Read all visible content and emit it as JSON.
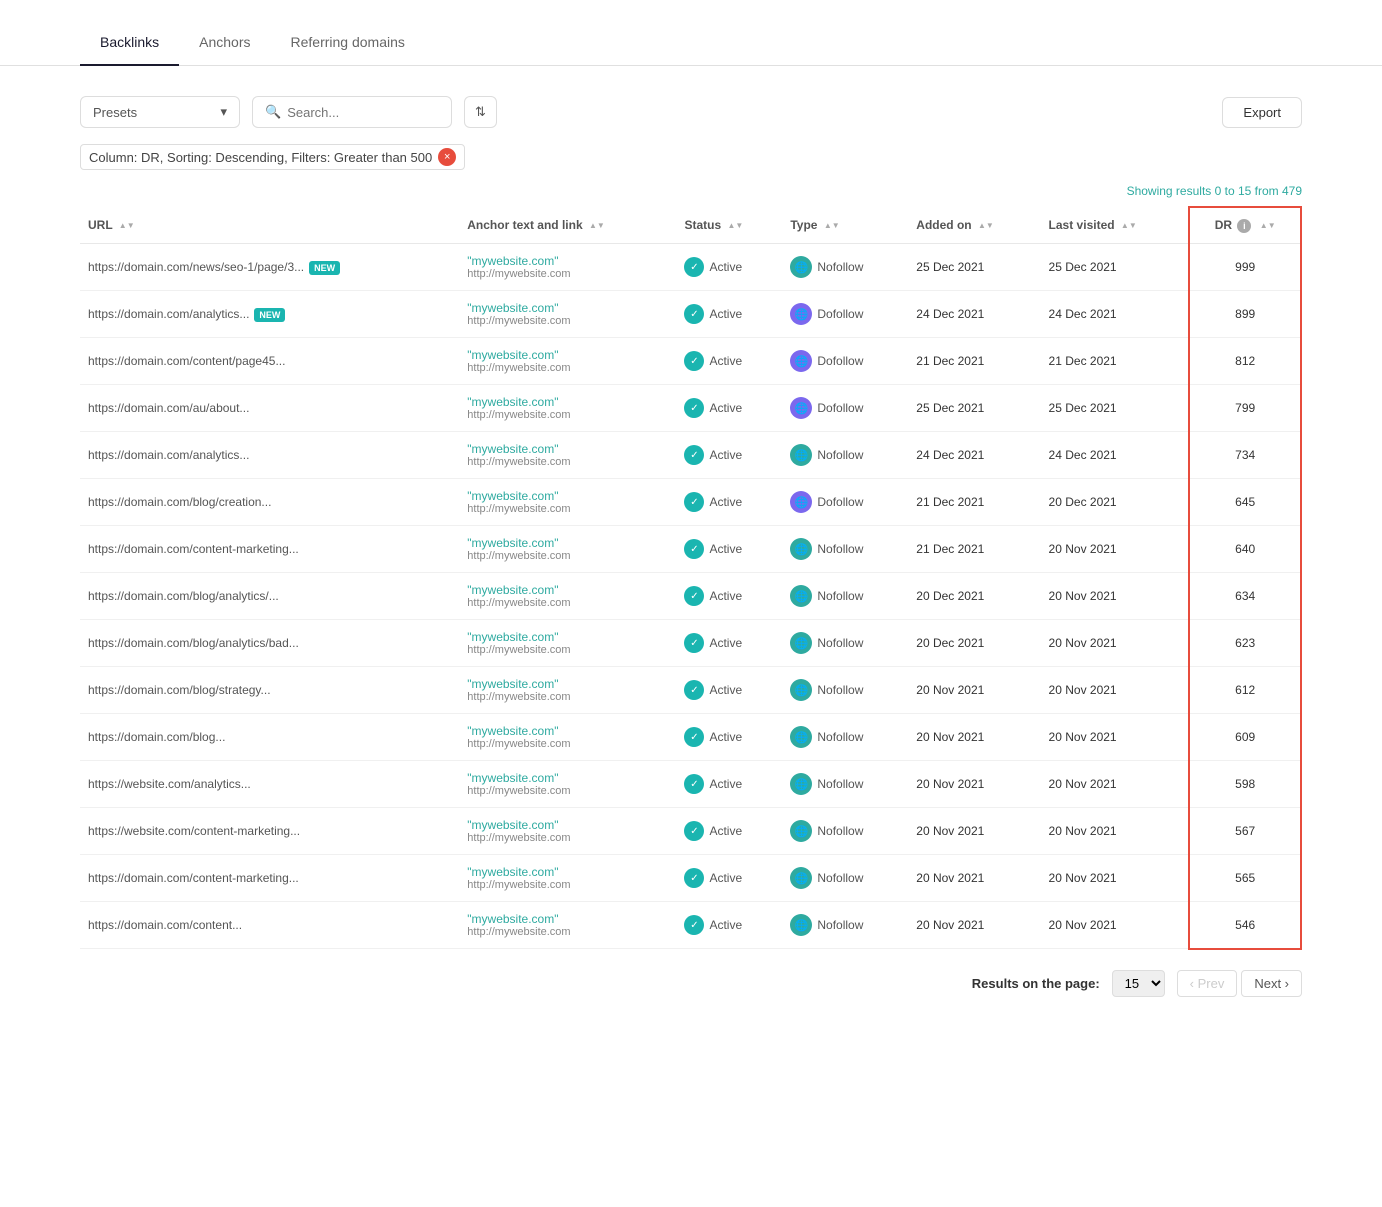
{
  "tabs": [
    {
      "id": "backlinks",
      "label": "Backlinks",
      "active": true
    },
    {
      "id": "anchors",
      "label": "Anchors",
      "active": false
    },
    {
      "id": "referring-domains",
      "label": "Referring domains",
      "active": false
    }
  ],
  "toolbar": {
    "presets_label": "Presets",
    "search_placeholder": "Search...",
    "export_label": "Export"
  },
  "active_filter": {
    "text": "Column: DR,  Sorting: Descending,  Filters: Greater than 500",
    "close_icon": "×"
  },
  "results": {
    "text": "Showing results 0 to 15 from 479"
  },
  "columns": [
    {
      "id": "url",
      "label": "URL"
    },
    {
      "id": "anchor",
      "label": "Anchor text and link"
    },
    {
      "id": "status",
      "label": "Status"
    },
    {
      "id": "type",
      "label": "Type"
    },
    {
      "id": "added_on",
      "label": "Added on"
    },
    {
      "id": "last_visited",
      "label": "Last visited"
    },
    {
      "id": "dr",
      "label": "DR"
    }
  ],
  "rows": [
    {
      "url": "https://domain.com/news/seo-1/page/3...",
      "is_new": true,
      "anchor_text": "\"mywebsite.com\"",
      "anchor_link": "http://mywebsite.com",
      "status": "Active",
      "type": "Nofollow",
      "type_style": "nofollow",
      "added_on": "25 Dec 2021",
      "last_visited": "25 Dec 2021",
      "dr": 999
    },
    {
      "url": "https://domain.com/analytics...",
      "is_new": true,
      "anchor_text": "\"mywebsite.com\"",
      "anchor_link": "http://mywebsite.com",
      "status": "Active",
      "type": "Dofollow",
      "type_style": "dofollow",
      "added_on": "24 Dec 2021",
      "last_visited": "24 Dec 2021",
      "dr": 899
    },
    {
      "url": "https://domain.com/content/page45...",
      "is_new": false,
      "anchor_text": "\"mywebsite.com\"",
      "anchor_link": "http://mywebsite.com",
      "status": "Active",
      "type": "Dofollow",
      "type_style": "dofollow",
      "added_on": "21 Dec 2021",
      "last_visited": "21 Dec 2021",
      "dr": 812
    },
    {
      "url": "https://domain.com/au/about...",
      "is_new": false,
      "anchor_text": "\"mywebsite.com\"",
      "anchor_link": "http://mywebsite.com",
      "status": "Active",
      "type": "Dofollow",
      "type_style": "dofollow",
      "added_on": "25 Dec 2021",
      "last_visited": "25 Dec 2021",
      "dr": 799
    },
    {
      "url": "https://domain.com/analytics...",
      "is_new": false,
      "anchor_text": "\"mywebsite.com\"",
      "anchor_link": "http://mywebsite.com",
      "status": "Active",
      "type": "Nofollow",
      "type_style": "nofollow",
      "added_on": "24 Dec 2021",
      "last_visited": "24 Dec 2021",
      "dr": 734
    },
    {
      "url": "https://domain.com/blog/creation...",
      "is_new": false,
      "anchor_text": "\"mywebsite.com\"",
      "anchor_link": "http://mywebsite.com",
      "status": "Active",
      "type": "Dofollow",
      "type_style": "dofollow",
      "added_on": "21 Dec 2021",
      "last_visited": "20 Dec 2021",
      "dr": 645
    },
    {
      "url": "https://domain.com/content-marketing...",
      "is_new": false,
      "anchor_text": "\"mywebsite.com\"",
      "anchor_link": "http://mywebsite.com",
      "status": "Active",
      "type": "Nofollow",
      "type_style": "nofollow",
      "added_on": "21 Dec 2021",
      "last_visited": "20 Nov 2021",
      "dr": 640
    },
    {
      "url": "https://domain.com/blog/analytics/...",
      "is_new": false,
      "anchor_text": "\"mywebsite.com\"",
      "anchor_link": "http://mywebsite.com",
      "status": "Active",
      "type": "Nofollow",
      "type_style": "nofollow",
      "added_on": "20 Dec 2021",
      "last_visited": "20 Nov 2021",
      "dr": 634
    },
    {
      "url": "https://domain.com/blog/analytics/bad...",
      "is_new": false,
      "anchor_text": "\"mywebsite.com\"",
      "anchor_link": "http://mywebsite.com",
      "status": "Active",
      "type": "Nofollow",
      "type_style": "nofollow",
      "added_on": "20 Dec 2021",
      "last_visited": "20 Nov 2021",
      "dr": 623
    },
    {
      "url": "https://domain.com/blog/strategy...",
      "is_new": false,
      "anchor_text": "\"mywebsite.com\"",
      "anchor_link": "http://mywebsite.com",
      "status": "Active",
      "type": "Nofollow",
      "type_style": "nofollow",
      "added_on": "20 Nov 2021",
      "last_visited": "20 Nov 2021",
      "dr": 612
    },
    {
      "url": "https://domain.com/blog...",
      "is_new": false,
      "anchor_text": "\"mywebsite.com\"",
      "anchor_link": "http://mywebsite.com",
      "status": "Active",
      "type": "Nofollow",
      "type_style": "nofollow",
      "added_on": "20 Nov 2021",
      "last_visited": "20 Nov 2021",
      "dr": 609
    },
    {
      "url": "https://website.com/analytics...",
      "is_new": false,
      "anchor_text": "\"mywebsite.com\"",
      "anchor_link": "http://mywebsite.com",
      "status": "Active",
      "type": "Nofollow",
      "type_style": "nofollow",
      "added_on": "20 Nov 2021",
      "last_visited": "20 Nov 2021",
      "dr": 598
    },
    {
      "url": "https://website.com/content-marketing...",
      "is_new": false,
      "anchor_text": "\"mywebsite.com\"",
      "anchor_link": "http://mywebsite.com",
      "status": "Active",
      "type": "Nofollow",
      "type_style": "nofollow",
      "added_on": "20 Nov 2021",
      "last_visited": "20 Nov 2021",
      "dr": 567
    },
    {
      "url": "https://domain.com/content-marketing...",
      "is_new": false,
      "anchor_text": "\"mywebsite.com\"",
      "anchor_link": "http://mywebsite.com",
      "status": "Active",
      "type": "Nofollow",
      "type_style": "nofollow",
      "added_on": "20 Nov 2021",
      "last_visited": "20 Nov 2021",
      "dr": 565
    },
    {
      "url": "https://domain.com/content...",
      "is_new": false,
      "anchor_text": "\"mywebsite.com\"",
      "anchor_link": "http://mywebsite.com",
      "status": "Active",
      "type": "Nofollow",
      "type_style": "nofollow",
      "added_on": "20 Nov 2021",
      "last_visited": "20 Nov 2021",
      "dr": 546
    }
  ],
  "pagination": {
    "label": "Results on the page:",
    "page_size": "15",
    "prev_label": "‹ Prev",
    "next_label": "Next ›"
  }
}
